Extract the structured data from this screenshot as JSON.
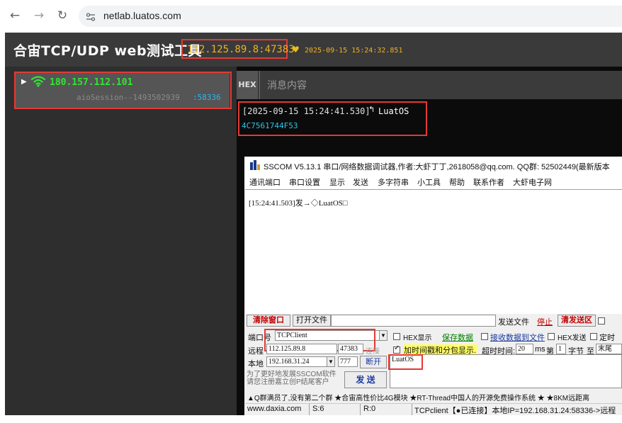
{
  "browser": {
    "url": "netlab.luatos.com"
  },
  "app": {
    "title": "合宙TCP/UDP web测试工具",
    "server_address": "112.125.89.8:47383",
    "server_time": "2025-09-15 15:24:32.851"
  },
  "clients": [
    {
      "ip": "180.157.112.101",
      "session": "aioSession--1493502939",
      "port": ":58336"
    }
  ],
  "message_panel": {
    "hex_label": "HEX",
    "input_placeholder": "消息内容"
  },
  "messages": [
    {
      "time": "[2025-09-15 15:24:41.530]",
      "text": "LuatOS",
      "hex": "4C7561744F53"
    }
  ],
  "sscom": {
    "title": "SSCOM V5.13.1 串口/网络数据调试器,作者:大虾丁丁,2618058@qq.com. QQ群: 52502449(最新版本",
    "menu": [
      "通讯端口",
      "串口设置",
      "显示",
      "发送",
      "多字符串",
      "小工具",
      "帮助",
      "联系作者",
      "大虾电子网"
    ],
    "receive_line": "[15:24:41.503]发→◇LuatOS□",
    "buttons": {
      "clear_window": "清除窗口",
      "open_file": "打开文件",
      "send_file": "发送文件",
      "stop": "停止",
      "clear_send": "清发送区",
      "save_data": "保存数据",
      "recv_to_file": "接收数据到文件",
      "disconnect": "断开",
      "send": "发 送",
      "connect": "连接"
    },
    "labels": {
      "port_no": "端口号",
      "remote": "远程",
      "local": "本地",
      "hex_display": "HEX显示",
      "timestamp": "加时间戳和分包显示.",
      "timeout": "超时时间:",
      "ms": "ms",
      "nth": "第",
      "byte": "字节",
      "to": "至",
      "end": "末尾",
      "hex_send": "HEX发送",
      "timed": "定时",
      "promo": "为了更好地发展SSCOM软件\n请您注册嘉立创P结尾客户"
    },
    "fields": {
      "port_type": "TCPClient",
      "remote_ip": "112.125.89.8",
      "remote_port": "47383",
      "local_ip": "192.168.31.24",
      "local_port": "777",
      "timeout_value": "20",
      "byte_value": "1",
      "send_text": "LuatOS"
    },
    "ticker": "▲Q群满员了,没有第二个群 ★合宙高性价比4G模块 ★RT-Thread中国人的开源免费操作系统 ★ ★8KM远距离",
    "status": {
      "site": "www.daxia.com",
      "sent": "S:6",
      "recv": "R:0",
      "conn": "TCPclient【●已连接】本地IP=192.168.31.24:58336->远程"
    }
  },
  "colors": {
    "header_bg": "#3a3a3a",
    "address_color": "#f0b020",
    "client_ip_color": "#2ee82e",
    "highlight_red": "#e53935",
    "hex_color": "#29c6e6"
  }
}
